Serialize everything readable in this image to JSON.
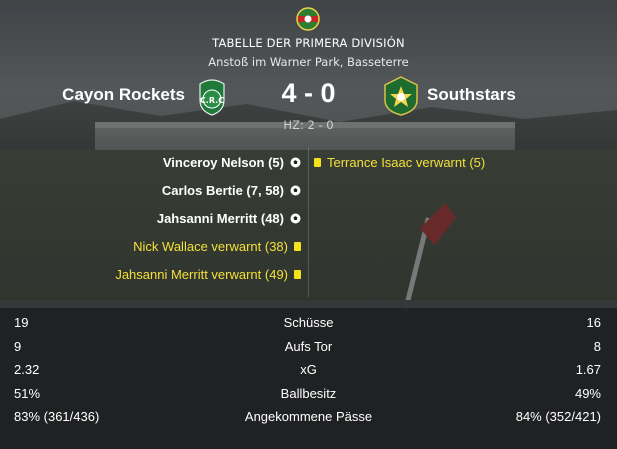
{
  "header": {
    "competition_icon": "competition-logo-icon",
    "title": "TABELLE DER PRIMERA DIVISIÓN",
    "venue": "Anstoß im Warner Park, Basseterre"
  },
  "match": {
    "home_team": "Cayon Rockets",
    "away_team": "Southstars",
    "score": "4 - 0",
    "half_time": "HZ: 2 - 0",
    "home_crest_icon": "cayon-rockets-crest-icon",
    "away_crest_icon": "southstars-crest-icon"
  },
  "events": {
    "home": [
      {
        "text": "Vinceroy Nelson (5)",
        "type": "goal"
      },
      {
        "text": "Carlos Bertie (7, 58)",
        "type": "goal"
      },
      {
        "text": "Jahsanni Merritt (48)",
        "type": "goal"
      },
      {
        "text": "Nick Wallace verwarnt (38)",
        "type": "yellow"
      },
      {
        "text": "Jahsanni Merritt verwarnt (49)",
        "type": "yellow"
      }
    ],
    "away": [
      {
        "text": "Terrance Isaac verwarnt (5)",
        "type": "yellow"
      }
    ]
  },
  "stats": [
    {
      "home": "19",
      "label": "Schüsse",
      "away": "16"
    },
    {
      "home": "9",
      "label": "Aufs Tor",
      "away": "8"
    },
    {
      "home": "2.32",
      "label": "xG",
      "away": "1.67"
    },
    {
      "home": "51%",
      "label": "Ballbesitz",
      "away": "49%"
    },
    {
      "home": "83% (361/436)",
      "label": "Angekommene Pässe",
      "away": "84% (352/421)"
    }
  ],
  "colors": {
    "yellow_card": "#f4e21d",
    "card_text": "#f3e03a",
    "home_crest": "#1f7a3a",
    "away_crest": "#1d6b2e"
  }
}
